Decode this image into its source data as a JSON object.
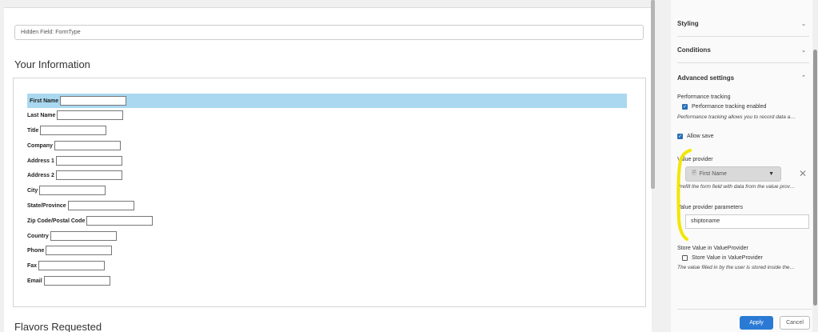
{
  "form": {
    "hidden_field": "Hidden Field: FormType",
    "section1_title": "Your Information",
    "section2_title": "Flavors Requested",
    "fields": [
      "First Name",
      "Last Name",
      "Title",
      "Company",
      "Address 1",
      "Address 2",
      "City",
      "State/Province",
      "Zip Code/Postal Code",
      "Country",
      "Phone",
      "Fax",
      "Email"
    ]
  },
  "panel": {
    "styling": "Styling",
    "conditions": "Conditions",
    "advanced": "Advanced settings",
    "perf_label": "Performance tracking",
    "perf_check": "Performance tracking enabled",
    "perf_hint": "Performance tracking allows you to record data a…",
    "allow_save": "Allow save",
    "value_provider_label": "Value provider",
    "value_provider_selected": "First Name",
    "value_provider_hint": "Prefill the form field with data from the value prov…",
    "vp_params_label": "Value provider parameters",
    "vp_params_value": "shiptoname",
    "store_label": "Store Value in ValueProvider",
    "store_check": "Store Value in ValueProvider",
    "store_hint": "The value filled in by the user is stored inside the…",
    "apply": "Apply",
    "cancel": "Cancel"
  },
  "icons": {
    "chevron_down": "chevron-down-icon",
    "chevron_up": "chevron-up-icon",
    "clear": "close-icon",
    "page": "document-icon"
  },
  "colors": {
    "highlight": "#a9d8f0",
    "accent": "#2a7ad5",
    "annotation": "#f2e600"
  }
}
